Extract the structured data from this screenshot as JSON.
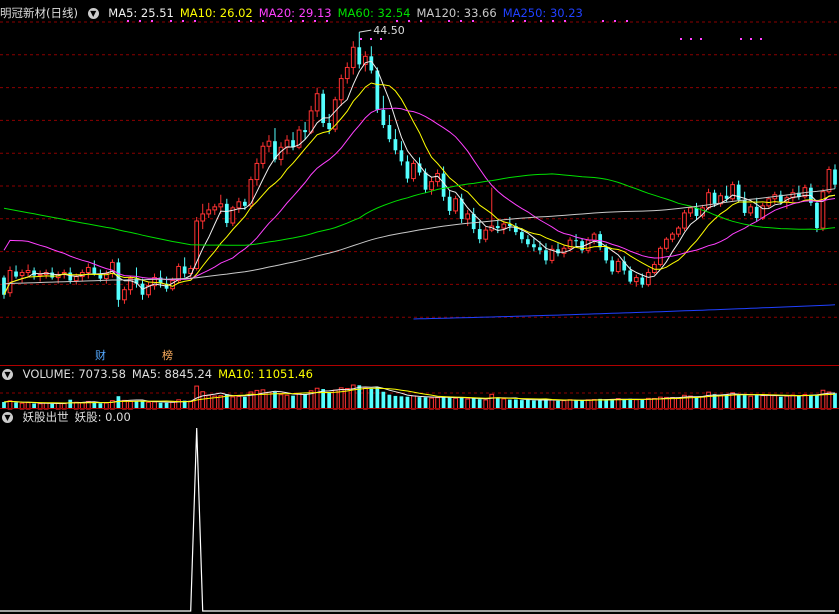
{
  "price_header": {
    "stock_title": "明冠新材(日线)",
    "ma_labels": [
      {
        "text": "MA5: 25.51",
        "color": "#f0f0f0"
      },
      {
        "text": "MA10: 26.02",
        "color": "#ffff00"
      },
      {
        "text": "MA20: 29.13",
        "color": "#ff40ff"
      },
      {
        "text": "MA60: 32.54",
        "color": "#00e000"
      },
      {
        "text": "MA120: 33.66",
        "color": "#c8c8c8"
      },
      {
        "text": "MA250: 30.23",
        "color": "#2040ff"
      }
    ]
  },
  "volume_header": {
    "labels": [
      {
        "text": "VOLUME: 7073.58",
        "color": "#dddddd"
      },
      {
        "text": "MA5: 8845.24",
        "color": "#dddddd"
      },
      {
        "text": "MA10: 11051.46",
        "color": "#ffff00"
      }
    ]
  },
  "indicator_header": {
    "labels": [
      {
        "text": "妖股出世",
        "color": "#dddddd"
      },
      {
        "text": "妖股: 0.00",
        "color": "#dddddd"
      }
    ]
  },
  "markers": {
    "cai": "财",
    "bang": "榜"
  },
  "colors": {
    "up": "#ff3232",
    "down": "#54ffff",
    "grid": "#8b0000",
    "ma5": "#f0f0f0",
    "ma10": "#ffff00",
    "ma20": "#ff40ff",
    "ma60": "#00e000",
    "ma120": "#c8c8c8",
    "ma250": "#2040ff"
  },
  "chart_data": {
    "type": "candlestick",
    "max_price_label": "44.50",
    "ohlc": [
      [
        20.2,
        20.4,
        18.1,
        18.5
      ],
      [
        18.7,
        21.3,
        18.3,
        20.9
      ],
      [
        20.8,
        21.4,
        20.1,
        20.3
      ],
      [
        20.4,
        21.0,
        19.7,
        20.7
      ],
      [
        20.7,
        21.5,
        20.3,
        20.9
      ],
      [
        20.9,
        21.2,
        20.0,
        20.4
      ],
      [
        20.4,
        20.9,
        19.8,
        20.5
      ],
      [
        20.5,
        21.0,
        20.1,
        20.7
      ],
      [
        20.7,
        21.2,
        20.0,
        20.2
      ],
      [
        20.2,
        20.8,
        19.6,
        20.5
      ],
      [
        20.5,
        21.0,
        20.1,
        20.7
      ],
      [
        20.7,
        21.2,
        19.6,
        19.9
      ],
      [
        19.9,
        20.6,
        19.5,
        20.3
      ],
      [
        20.3,
        21.0,
        19.8,
        20.7
      ],
      [
        20.7,
        21.6,
        20.1,
        21.2
      ],
      [
        21.2,
        21.9,
        20.4,
        20.6
      ],
      [
        20.6,
        21.0,
        19.8,
        20.1
      ],
      [
        20.1,
        20.9,
        19.6,
        20.6
      ],
      [
        20.6,
        22.0,
        20.2,
        21.7
      ],
      [
        21.7,
        22.1,
        17.3,
        18.0
      ],
      [
        18.0,
        19.3,
        17.6,
        19.0
      ],
      [
        19.0,
        20.4,
        18.5,
        20.1
      ],
      [
        20.1,
        21.2,
        19.2,
        19.6
      ],
      [
        19.6,
        20.1,
        18.0,
        18.5
      ],
      [
        18.5,
        19.7,
        18.2,
        19.4
      ],
      [
        19.4,
        20.6,
        19.0,
        20.2
      ],
      [
        20.2,
        20.9,
        19.2,
        19.6
      ],
      [
        19.6,
        20.3,
        18.8,
        19.1
      ],
      [
        19.1,
        20.2,
        18.9,
        19.9
      ],
      [
        19.9,
        21.6,
        19.6,
        21.3
      ],
      [
        21.3,
        22.2,
        20.2,
        20.6
      ],
      [
        20.6,
        21.4,
        20.2,
        21.1
      ],
      [
        21.1,
        26.2,
        20.9,
        25.8
      ],
      [
        25.8,
        27.5,
        25.0,
        26.5
      ],
      [
        26.5,
        27.6,
        26.1,
        26.9
      ],
      [
        26.9,
        27.5,
        26.4,
        27.2
      ],
      [
        27.2,
        28.4,
        26.5,
        27.5
      ],
      [
        27.5,
        28.0,
        25.2,
        25.6
      ],
      [
        25.6,
        27.3,
        25.3,
        27.1
      ],
      [
        27.1,
        28.1,
        26.6,
        27.7
      ],
      [
        27.7,
        28.0,
        26.9,
        27.3
      ],
      [
        27.3,
        30.2,
        27.0,
        29.9
      ],
      [
        29.9,
        32.0,
        29.3,
        31.5
      ],
      [
        31.5,
        33.6,
        31.0,
        33.2
      ],
      [
        33.2,
        34.3,
        32.6,
        33.7
      ],
      [
        33.7,
        35.0,
        31.6,
        31.9
      ],
      [
        31.9,
        33.6,
        31.3,
        33.1
      ],
      [
        33.1,
        34.3,
        32.4,
        33.8
      ],
      [
        33.8,
        34.6,
        32.8,
        33.1
      ],
      [
        33.1,
        35.2,
        32.9,
        34.8
      ],
      [
        34.8,
        35.6,
        33.9,
        34.6
      ],
      [
        34.6,
        37.2,
        34.4,
        36.7
      ],
      [
        36.7,
        39.0,
        36.1,
        38.4
      ],
      [
        38.4,
        38.8,
        35.1,
        35.5
      ],
      [
        35.5,
        36.4,
        34.4,
        34.9
      ],
      [
        34.9,
        38.1,
        34.6,
        37.8
      ],
      [
        37.8,
        40.3,
        37.2,
        39.9
      ],
      [
        39.9,
        41.5,
        39.4,
        41.0
      ],
      [
        41.0,
        43.6,
        40.3,
        43.0
      ],
      [
        43.0,
        44.5,
        40.9,
        41.3
      ],
      [
        41.3,
        42.6,
        40.6,
        42.1
      ],
      [
        42.1,
        43.1,
        40.4,
        40.7
      ],
      [
        40.7,
        41.0,
        36.5,
        36.8
      ],
      [
        36.8,
        38.2,
        35.0,
        35.3
      ],
      [
        35.3,
        36.3,
        33.6,
        33.9
      ],
      [
        33.9,
        34.9,
        32.4,
        32.8
      ],
      [
        32.8,
        33.7,
        31.3,
        31.7
      ],
      [
        31.7,
        32.3,
        29.6,
        30.0
      ],
      [
        30.0,
        31.8,
        29.7,
        31.5
      ],
      [
        31.5,
        32.1,
        30.3,
        30.6
      ],
      [
        30.6,
        31.0,
        28.6,
        28.9
      ],
      [
        28.9,
        30.1,
        28.4,
        29.7
      ],
      [
        29.7,
        30.9,
        29.2,
        30.5
      ],
      [
        30.5,
        31.2,
        27.8,
        28.2
      ],
      [
        28.2,
        28.8,
        26.4,
        26.8
      ],
      [
        26.8,
        28.3,
        26.5,
        28.0
      ],
      [
        28.0,
        28.5,
        25.6,
        26.0
      ],
      [
        26.0,
        26.9,
        25.3,
        26.5
      ],
      [
        26.5,
        27.1,
        24.6,
        25.0
      ],
      [
        25.0,
        25.8,
        23.6,
        24.0
      ],
      [
        24.0,
        25.2,
        23.7,
        24.9
      ],
      [
        24.9,
        29.1,
        24.7,
        25.3
      ],
      [
        25.3,
        25.9,
        24.6,
        25.1
      ],
      [
        25.1,
        25.8,
        24.5,
        25.5
      ],
      [
        25.5,
        26.2,
        24.8,
        25.3
      ],
      [
        25.3,
        25.6,
        24.4,
        24.7
      ],
      [
        24.7,
        25.1,
        23.6,
        24.0
      ],
      [
        24.0,
        24.4,
        23.2,
        23.5
      ],
      [
        23.5,
        24.1,
        22.8,
        23.2
      ],
      [
        23.2,
        23.8,
        22.5,
        22.9
      ],
      [
        22.9,
        23.6,
        21.5,
        21.9
      ],
      [
        21.9,
        23.4,
        21.6,
        23.0
      ],
      [
        23.0,
        23.6,
        22.3,
        22.6
      ],
      [
        22.6,
        23.4,
        22.2,
        23.1
      ],
      [
        23.1,
        24.2,
        22.8,
        23.9
      ],
      [
        23.9,
        24.5,
        23.3,
        23.8
      ],
      [
        23.8,
        24.1,
        22.6,
        22.9
      ],
      [
        22.9,
        24.2,
        22.6,
        23.9
      ],
      [
        23.9,
        24.7,
        23.5,
        24.5
      ],
      [
        24.5,
        24.8,
        22.9,
        23.2
      ],
      [
        23.2,
        23.5,
        21.6,
        21.9
      ],
      [
        21.9,
        22.3,
        20.5,
        20.8
      ],
      [
        20.8,
        22.1,
        20.6,
        21.8
      ],
      [
        21.8,
        22.3,
        20.5,
        20.9
      ],
      [
        20.9,
        21.3,
        19.6,
        19.8
      ],
      [
        19.8,
        20.5,
        19.3,
        20.2
      ],
      [
        20.2,
        20.6,
        19.2,
        19.5
      ],
      [
        19.5,
        21.1,
        19.3,
        20.7
      ],
      [
        20.7,
        21.8,
        20.5,
        21.5
      ],
      [
        21.5,
        23.3,
        21.3,
        23.1
      ],
      [
        23.1,
        24.2,
        22.9,
        24.0
      ],
      [
        24.0,
        24.7,
        23.7,
        24.5
      ],
      [
        24.5,
        25.3,
        24.2,
        25.1
      ],
      [
        25.1,
        26.9,
        24.8,
        26.6
      ],
      [
        26.6,
        27.3,
        26.2,
        27.1
      ],
      [
        27.1,
        27.6,
        25.9,
        26.3
      ],
      [
        26.3,
        27.4,
        26.1,
        27.1
      ],
      [
        27.1,
        29.0,
        26.9,
        28.6
      ],
      [
        28.6,
        28.9,
        27.2,
        27.5
      ],
      [
        27.5,
        28.6,
        27.2,
        28.3
      ],
      [
        28.3,
        29.3,
        27.7,
        28.0
      ],
      [
        28.0,
        29.7,
        27.8,
        29.4
      ],
      [
        29.4,
        29.8,
        27.6,
        27.9
      ],
      [
        27.9,
        28.7,
        26.3,
        26.6
      ],
      [
        26.6,
        27.5,
        26.3,
        27.2
      ],
      [
        27.2,
        28.1,
        25.8,
        26.1
      ],
      [
        26.1,
        27.6,
        25.9,
        27.3
      ],
      [
        27.3,
        28.2,
        27.1,
        28.0
      ],
      [
        28.0,
        28.7,
        27.5,
        28.4
      ],
      [
        28.4,
        28.8,
        27.4,
        27.7
      ],
      [
        27.7,
        28.3,
        27.0,
        28.1
      ],
      [
        28.1,
        29.0,
        27.7,
        28.6
      ],
      [
        28.6,
        29.3,
        27.9,
        28.2
      ],
      [
        28.2,
        29.4,
        28.0,
        29.1
      ],
      [
        29.1,
        29.5,
        27.3,
        27.6
      ],
      [
        27.6,
        27.9,
        24.7,
        25.1
      ],
      [
        25.1,
        29.0,
        24.8,
        28.7
      ],
      [
        28.7,
        31.2,
        28.5,
        30.9
      ],
      [
        30.9,
        31.4,
        29.0,
        29.4
      ]
    ],
    "volume": [
      5200,
      6100,
      4800,
      4300,
      4700,
      4100,
      3900,
      4400,
      3800,
      4200,
      4000,
      6900,
      5000,
      4500,
      5600,
      4800,
      4300,
      4500,
      6200,
      9500,
      6400,
      5600,
      5800,
      5900,
      5000,
      5300,
      4700,
      4600,
      5100,
      6800,
      6200,
      5800,
      17000,
      12800,
      10100,
      9600,
      9900,
      11000,
      9000,
      9300,
      8900,
      12600,
      13800,
      14200,
      12400,
      12600,
      10600,
      10200,
      9900,
      11600,
      11200,
      13500,
      15400,
      14800,
      12300,
      14000,
      15700,
      15200,
      17800,
      17600,
      15400,
      15000,
      16000,
      12800,
      10600,
      9700,
      9400,
      9100,
      9700,
      8800,
      8700,
      8100,
      8400,
      9300,
      8500,
      8000,
      8200,
      7400,
      7900,
      7300,
      6700,
      10900,
      8600,
      7500,
      7000,
      7100,
      6600,
      6900,
      6400,
      6300,
      7300,
      6700,
      6100,
      6200,
      6900,
      6400,
      6300,
      6800,
      7000,
      7500,
      7200,
      7000,
      7700,
      6700,
      7600,
      6900,
      6800,
      7900,
      7800,
      8800,
      8600,
      8500,
      8300,
      10200,
      9600,
      9000,
      9300,
      12500,
      11000,
      10300,
      10800,
      12100,
      10600,
      10300,
      9500,
      10300,
      9900,
      10600,
      9900,
      9100,
      9600,
      10400,
      9800,
      10700,
      10500,
      10800,
      13900,
      12600,
      11700
    ],
    "indicator": {
      "name": "妖股出世",
      "series_name": "妖股",
      "spike_index": 32,
      "spike_value": 1
    }
  }
}
